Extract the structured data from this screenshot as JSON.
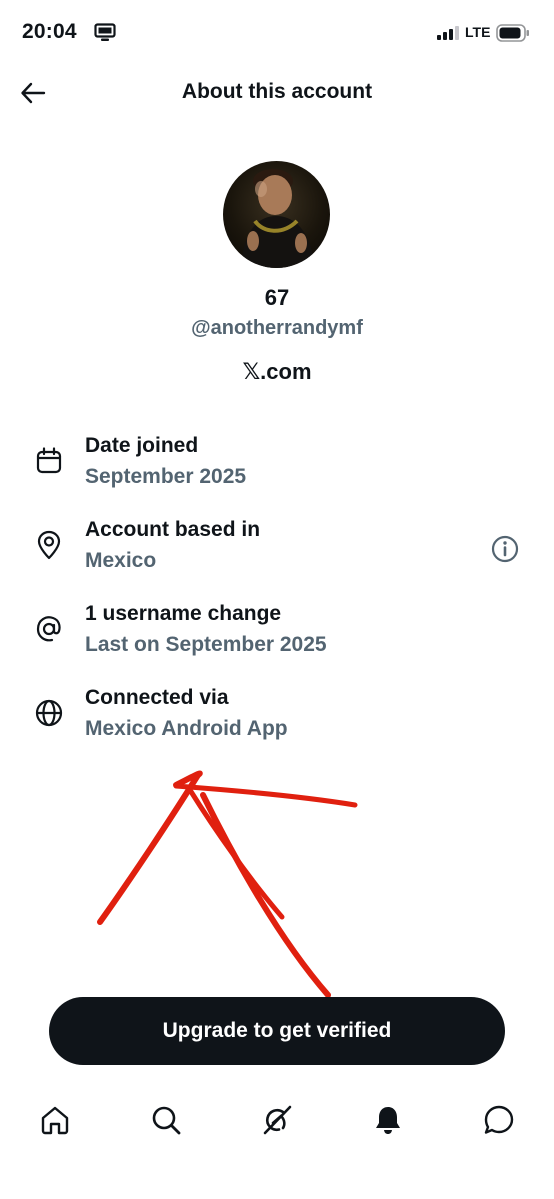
{
  "status_bar": {
    "time": "20:04",
    "network": "LTE",
    "icons": [
      "screen-mirroring-icon",
      "signal-bars-icon",
      "battery-icon"
    ]
  },
  "header": {
    "title": "About this account",
    "back_icon": "arrow-left-icon"
  },
  "profile": {
    "display_name": "67",
    "handle": "@anotherrandymf",
    "source": "𝕏.com"
  },
  "info": [
    {
      "icon": "calendar-icon",
      "label": "Date joined",
      "value": "September 2025"
    },
    {
      "icon": "location-pin-icon",
      "label": "Account based in",
      "value": "Mexico",
      "action_icon": "info-circle-icon"
    },
    {
      "icon": "at-sign-icon",
      "label": "1 username change",
      "value": "Last on September 2025"
    },
    {
      "icon": "globe-icon",
      "label": "Connected via",
      "value": "Mexico Android App"
    }
  ],
  "cta": {
    "label": "Upgrade to get verified"
  },
  "tab_bar": {
    "tabs": [
      "home-icon",
      "search-icon",
      "grok-icon",
      "notifications-bell-icon",
      "messages-icon"
    ]
  },
  "colors": {
    "primary_text": "#0f1419",
    "secondary_text": "#536471",
    "cta_background": "#0f1419",
    "annotation": "#e0200f"
  }
}
